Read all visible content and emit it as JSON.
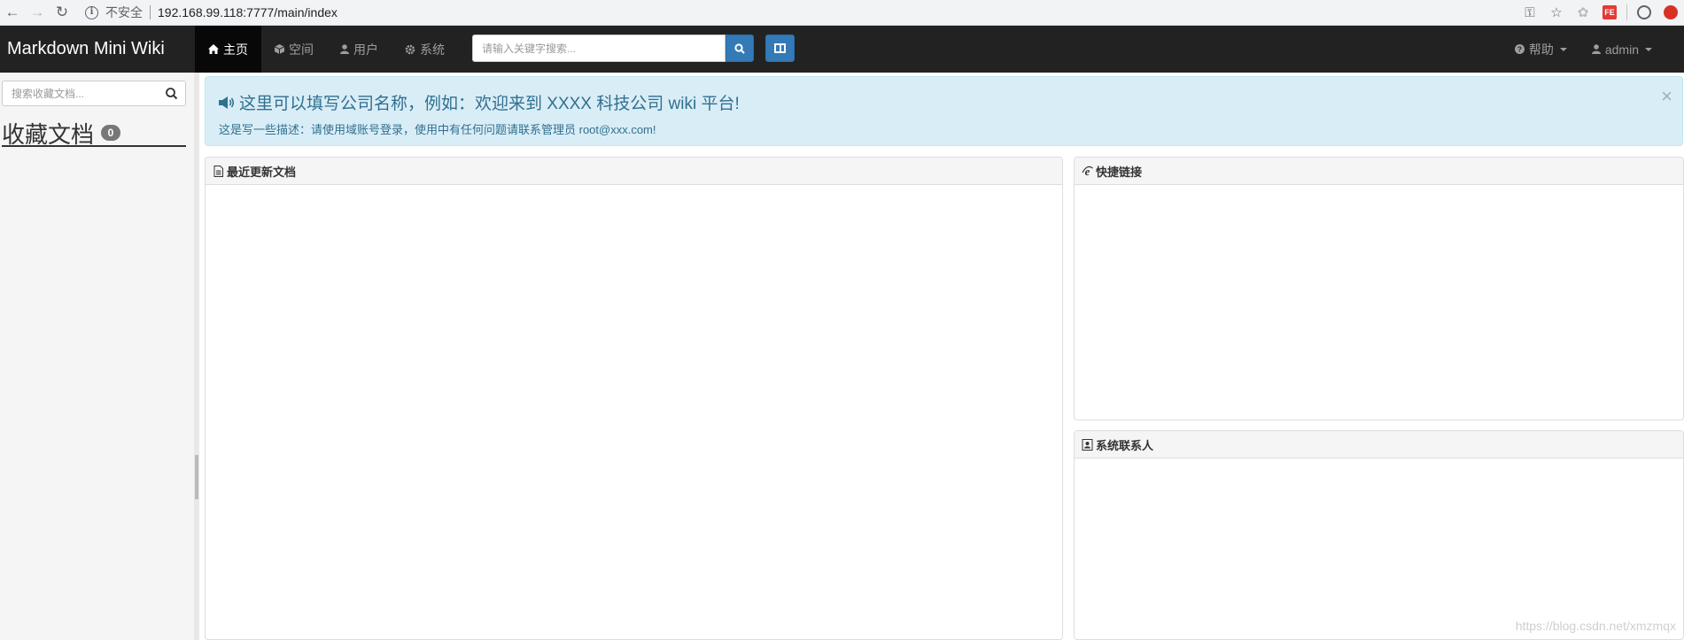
{
  "browser": {
    "insecure_label": "不安全",
    "url": "192.168.99.118:7777/main/index",
    "ext_fe_label": "FE"
  },
  "navbar": {
    "brand": "Markdown Mini Wiki",
    "menu": [
      {
        "label": "主页",
        "icon": "home-icon",
        "active": true
      },
      {
        "label": "空间",
        "icon": "cube-icon"
      },
      {
        "label": "用户",
        "icon": "user-icon"
      },
      {
        "label": "系统",
        "icon": "gear-icon"
      }
    ],
    "search_placeholder": "请输入关键字搜索...",
    "help_label": "帮助",
    "user_label": "admin"
  },
  "sidebar": {
    "search_placeholder": "搜索收藏文档...",
    "title": "收藏文档",
    "count": "0"
  },
  "alert": {
    "title": "这里可以填写公司名称，例如：欢迎来到 XXXX 科技公司 wiki 平台!",
    "description": "这是写一些描述：请使用域账号登录，使用中有任何问题请联系管理员 root@xxx.com!",
    "close_glyph": "×"
  },
  "panels": {
    "recent_title": "最近更新文档",
    "links_title": "快捷链接",
    "contacts_title": "系统联系人"
  },
  "watermark": "https://blog.csdn.net/xmzmqx",
  "colors": {
    "navbar_bg": "#222222",
    "primary": "#337ab7",
    "alert_bg": "#d9edf7",
    "alert_text": "#31708f"
  }
}
